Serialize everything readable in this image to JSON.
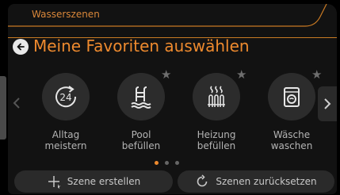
{
  "header": {
    "section_title": "Wasserszenen",
    "page_title": "Meine Favoriten auswählen"
  },
  "icons": {
    "back": "arrow-left-icon",
    "prev": "chevron-left-icon",
    "next": "chevron-right-icon",
    "star": "star-icon"
  },
  "tiles": [
    {
      "line1": "Alltag",
      "line2": "meistern",
      "icon": "24-hour-icon"
    },
    {
      "line1": "Pool",
      "line2": "befüllen",
      "icon": "pool-icon"
    },
    {
      "line1": "Heizung",
      "line2": "befüllen",
      "icon": "heating-icon"
    },
    {
      "line1": "Wäsche",
      "line2": "waschen",
      "icon": "washing-machine-icon"
    }
  ],
  "pagination": {
    "pages": 3,
    "current": 1
  },
  "actions": {
    "create_label": "Szene erstellen",
    "reset_label": "Szenen zurücksetzen"
  },
  "colors": {
    "accent": "#ee8a2e",
    "background": "#121212",
    "tile": "#2c2c2c"
  }
}
